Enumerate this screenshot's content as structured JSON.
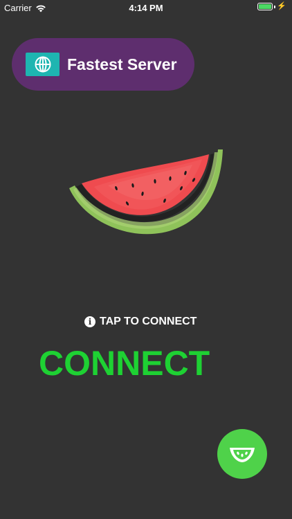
{
  "status_bar": {
    "carrier": "Carrier",
    "time": "4:14 PM",
    "battery_bolt": "⚡"
  },
  "server_selector": {
    "label": "Fastest Server",
    "icon": "globe-icon"
  },
  "hero": {
    "icon": "watermelon-slice-icon"
  },
  "hint": {
    "icon": "info-icon",
    "icon_glyph": "i",
    "text": "TAP TO CONNECT"
  },
  "connect": {
    "label": "CONNECT"
  },
  "fab": {
    "icon": "watermelon-wedge-icon"
  },
  "colors": {
    "background": "#333333",
    "pill": "#5e2e6e",
    "globe_box": "#1eb5b1",
    "connect_text": "#1ed133",
    "fab": "#4fd24a",
    "battery": "#4cd964"
  }
}
